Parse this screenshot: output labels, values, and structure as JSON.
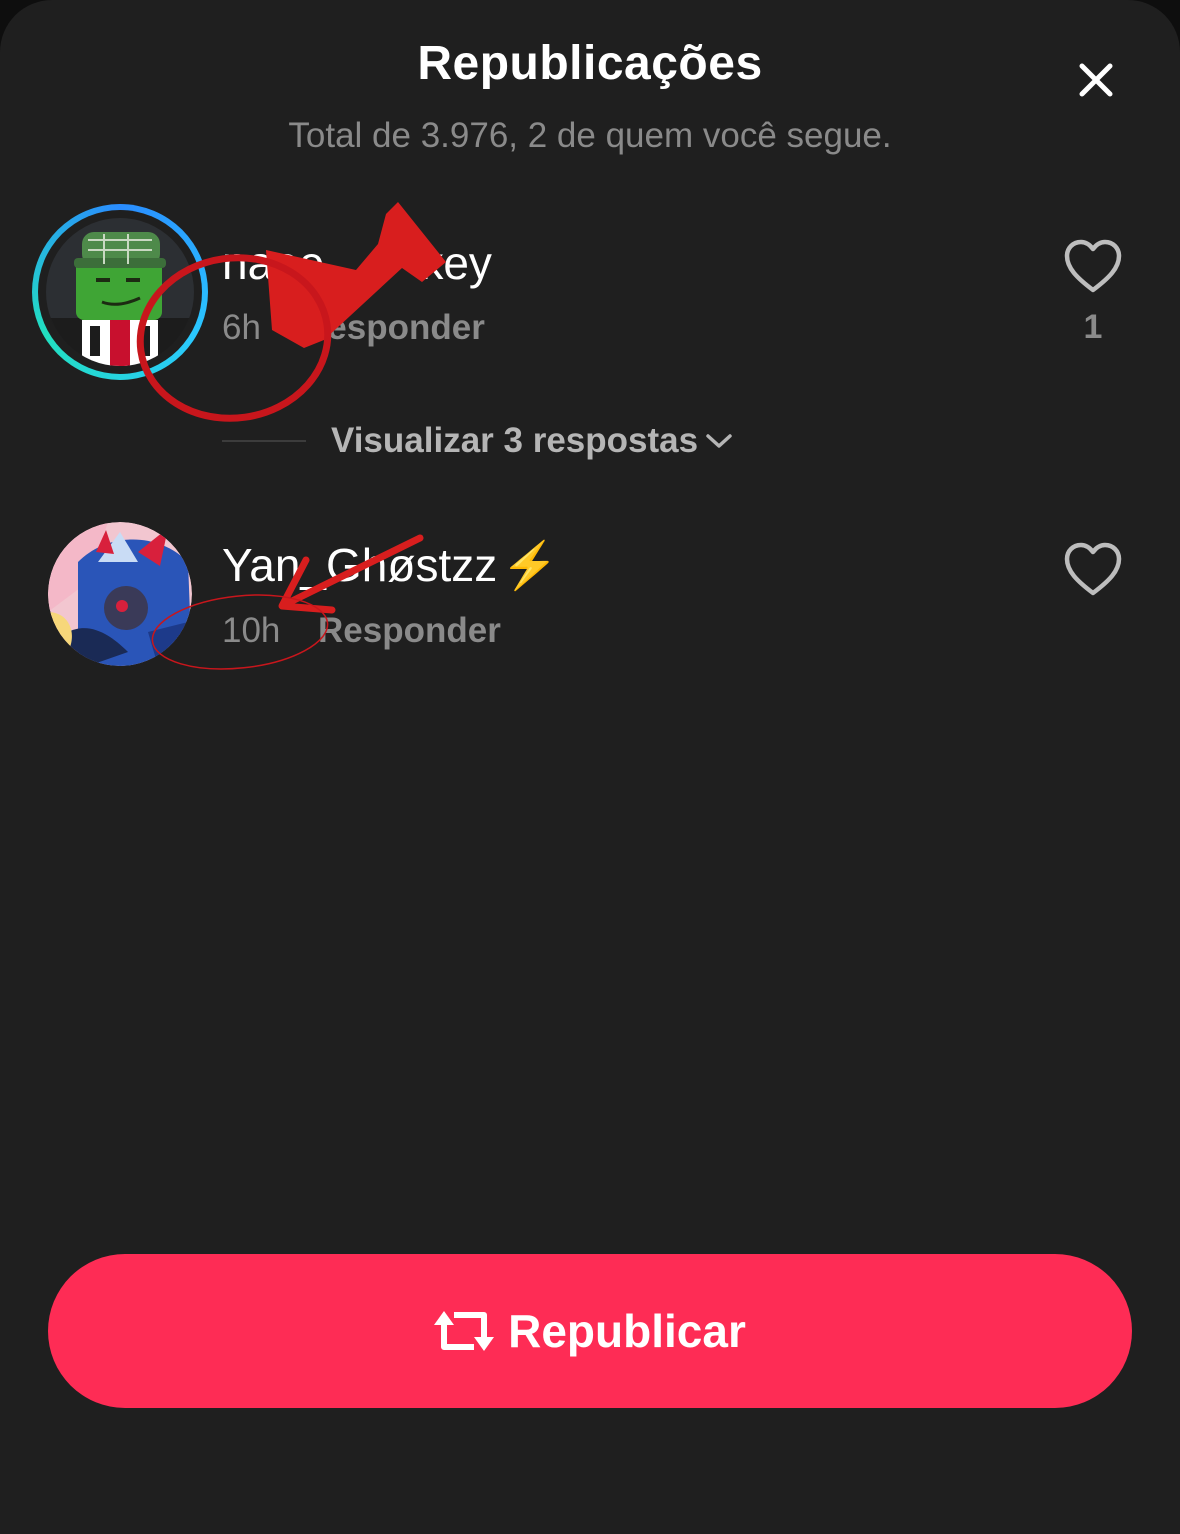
{
  "header": {
    "title": "Republicações",
    "subtitle": "Total de 3.976, 2 de quem você segue."
  },
  "reposts": [
    {
      "username": "naoe",
      "username_tail": "key",
      "time": "6h",
      "reply_label": "Responder",
      "like_count": "1",
      "view_replies_label": "Visualizar 3 respostas"
    },
    {
      "username": "Yan_Ghøstzz",
      "badge_emoji": "⚡",
      "time": "10h",
      "reply_label": "Responder"
    }
  ],
  "footer": {
    "republish_label": "Republicar"
  },
  "icons": {
    "close": "close-icon",
    "heart": "heart-icon",
    "chevron": "chevron-down-icon",
    "repost": "repost-icon"
  },
  "colors": {
    "background": "#1f1f1f",
    "accent": "#fe2c55",
    "muted_text": "#8a8a8a",
    "annotation_red": "#d81e1e"
  }
}
